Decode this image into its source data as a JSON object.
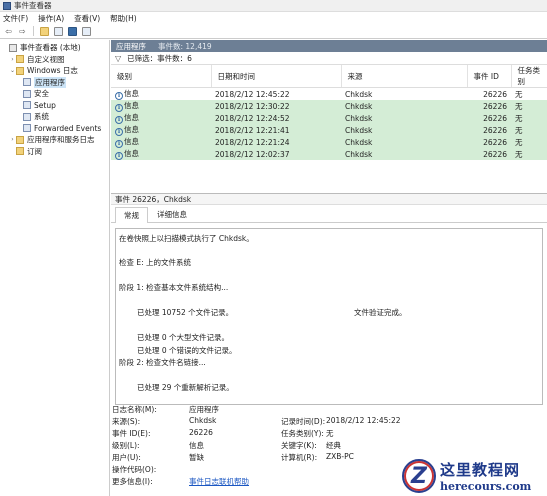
{
  "window": {
    "title": "事件查看器"
  },
  "menu": [
    "文件(F)",
    "操作(A)",
    "查看(V)",
    "帮助(H)"
  ],
  "tree": [
    {
      "label": "事件查看器 (本地)",
      "indent": 0,
      "expander": "",
      "icon": "event-viewer-icon"
    },
    {
      "label": "自定义视图",
      "indent": 1,
      "expander": "›",
      "icon": "folder-icon"
    },
    {
      "label": "Windows 日志",
      "indent": 1,
      "expander": "⌄",
      "icon": "folder-icon"
    },
    {
      "label": "应用程序",
      "indent": 2,
      "expander": "",
      "icon": "log-icon",
      "selected": true
    },
    {
      "label": "安全",
      "indent": 2,
      "expander": "",
      "icon": "log-icon"
    },
    {
      "label": "Setup",
      "indent": 2,
      "expander": "",
      "icon": "log-icon"
    },
    {
      "label": "系统",
      "indent": 2,
      "expander": "",
      "icon": "log-icon"
    },
    {
      "label": "Forwarded Events",
      "indent": 2,
      "expander": "",
      "icon": "log-icon"
    },
    {
      "label": "应用程序和服务日志",
      "indent": 1,
      "expander": "›",
      "icon": "folder-icon"
    },
    {
      "label": "订阅",
      "indent": 1,
      "expander": "",
      "icon": "folder-icon"
    }
  ],
  "log": {
    "name": "应用程序",
    "count_text": "事件数: 12,419"
  },
  "filter": {
    "text": "已筛选：事件数：6"
  },
  "columns": [
    "级别",
    "日期和时间",
    "来源",
    "事件 ID",
    "任务类别"
  ],
  "events": [
    {
      "level": "信息",
      "datetime": "2018/2/12 12:45:22",
      "source": "Chkdsk",
      "id": "26226",
      "task": "无"
    },
    {
      "level": "信息",
      "datetime": "2018/2/12 12:30:22",
      "source": "Chkdsk",
      "id": "26226",
      "task": "无"
    },
    {
      "level": "信息",
      "datetime": "2018/2/12 12:24:52",
      "source": "Chkdsk",
      "id": "26226",
      "task": "无"
    },
    {
      "level": "信息",
      "datetime": "2018/2/12 12:21:41",
      "source": "Chkdsk",
      "id": "26226",
      "task": "无"
    },
    {
      "level": "信息",
      "datetime": "2018/2/12 12:21:24",
      "source": "Chkdsk",
      "id": "26226",
      "task": "无"
    },
    {
      "level": "信息",
      "datetime": "2018/2/12 12:02:37",
      "source": "Chkdsk",
      "id": "26226",
      "task": "无"
    }
  ],
  "detail": {
    "header": "事件 26226，Chkdsk"
  },
  "tabs": [
    "常规",
    "详细信息"
  ],
  "message": {
    "line1": "在卷快照上以扫描模式执行了 Chkdsk。",
    "line2": "检查 E: 上的文件系统",
    "line3": "阶段 1: 检查基本文件系统结构...",
    "line4a": "已处理 10752 个文件记录。",
    "line4b": "文件验证完成。",
    "line5": "已处理 0 个大型文件记录。",
    "line6": "已处理 0 个错误的文件记录。",
    "line7": "阶段 2: 检查文件名链接...",
    "line8": "已处理 29 个重新解析记录。"
  },
  "props": {
    "log_name_label": "日志名称(M):",
    "log_name_value": "应用程序",
    "source_label": "来源(S):",
    "source_value": "Chkdsk",
    "logged_label": "记录时间(D):",
    "logged_value": "2018/2/12 12:45:22",
    "event_id_label": "事件 ID(E):",
    "event_id_value": "26226",
    "task_label": "任务类别(Y):",
    "task_value": "无",
    "level_label": "级别(L):",
    "level_value": "信息",
    "keywords_label": "关键字(K):",
    "keywords_value": "经典",
    "user_label": "用户(U):",
    "user_value": "暂缺",
    "computer_label": "计算机(R):",
    "computer_value": "ZXB-PC",
    "opcode_label": "操作代码(O):",
    "more_label": "更多信息(I):",
    "more_link": "事件日志联机帮助"
  },
  "watermark": {
    "cn": "这里教程网",
    "url": "herecours.com"
  }
}
